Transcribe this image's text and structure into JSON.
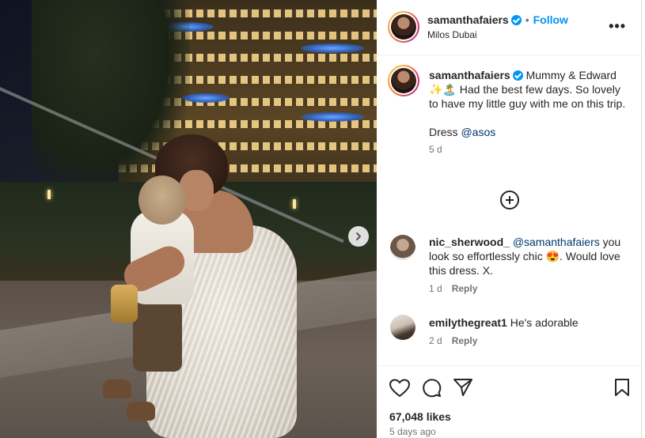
{
  "post": {
    "author": "samanthafaiers",
    "follow_label": "Follow",
    "location": "Milos Dubai",
    "more_label": "•••",
    "caption_text": "Mummy & Edward ✨🏝️ Had the best few days. So lovely to have my little guy with me on this trip.",
    "caption_dress": "Dress",
    "caption_mention": "@asos",
    "caption_time": "5 d"
  },
  "comments": [
    {
      "username": "nic_sherwood_",
      "mention": "@samanthafaiers",
      "text": "you look so effortlessly chic 😍. Would love this dress. X.",
      "time": "1 d",
      "reply_label": "Reply"
    },
    {
      "username": "emilythegreat1",
      "text": "He's adorable",
      "time": "2 d",
      "reply_label": "Reply"
    }
  ],
  "stats": {
    "likes": "67,048 likes",
    "posted": "5 days ago"
  },
  "colors": {
    "accent_blue": "#0095f6",
    "mention_blue": "#00376b",
    "text": "#262626",
    "muted": "#737373"
  },
  "icons": [
    "chevron-right-icon",
    "verified-icon",
    "more-icon",
    "plus-circle-icon",
    "heart-icon",
    "comment-icon",
    "share-icon",
    "bookmark-icon"
  ]
}
